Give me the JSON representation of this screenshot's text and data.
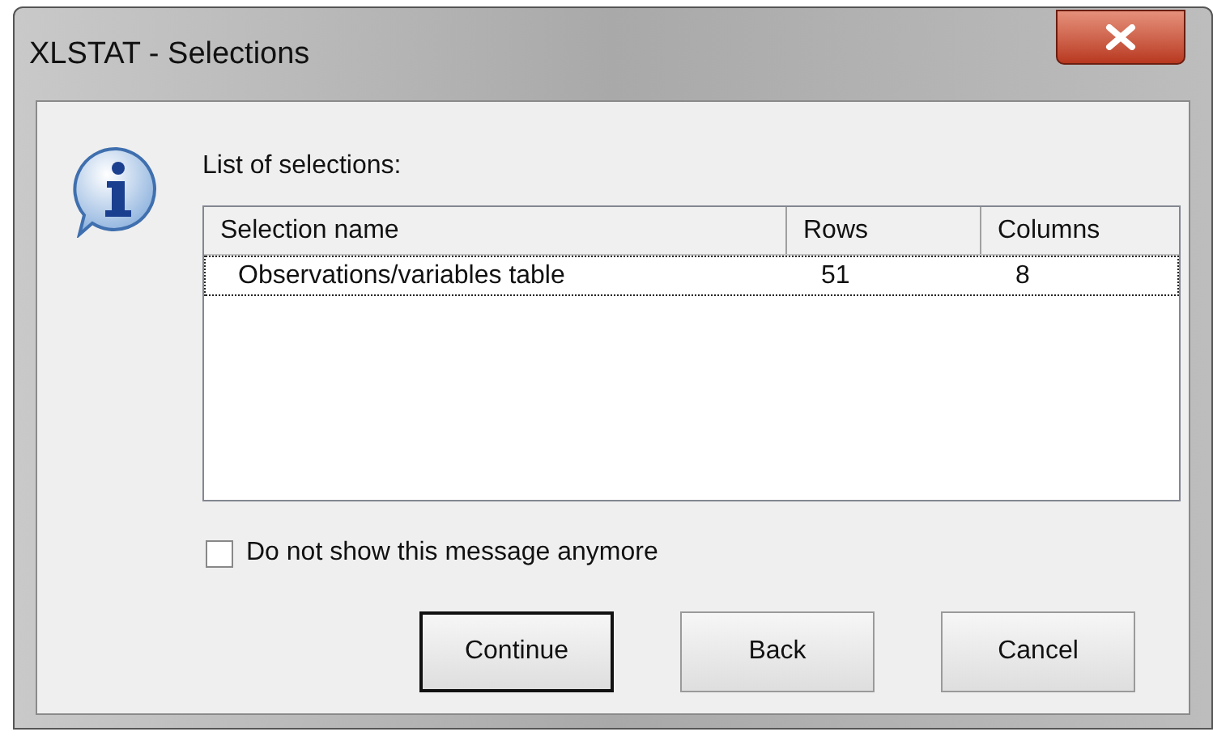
{
  "window": {
    "title": "XLSTAT - Selections"
  },
  "prompt": "List of selections:",
  "table": {
    "columns": [
      "Selection name",
      "Rows",
      "Columns"
    ],
    "rows": [
      {
        "cells": [
          "Observations/variables table",
          "51",
          "8"
        ],
        "selected": true
      }
    ]
  },
  "checkbox": {
    "label": "Do not show this message anymore",
    "checked": false
  },
  "buttons": [
    {
      "label": "Continue",
      "default": true
    },
    {
      "label": "Back",
      "default": false
    },
    {
      "label": "Cancel",
      "default": false
    }
  ]
}
